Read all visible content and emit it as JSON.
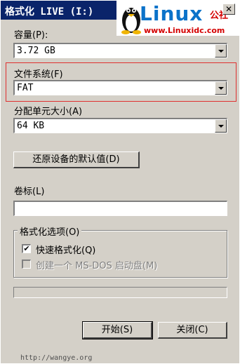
{
  "window": {
    "title": "格式化 LIVE (I:)",
    "close_glyph": "✕"
  },
  "overlay_logo": {
    "word": "Linux",
    "cn": "公社",
    "url": "www.Linuxidc.com"
  },
  "capacity": {
    "label": "容量(P):",
    "value": "3.72 GB"
  },
  "filesystem": {
    "label": "文件系统(F)",
    "value": "FAT"
  },
  "allocation": {
    "label": "分配单元大小(A)",
    "value": "64 KB"
  },
  "restore_defaults_label": "还原设备的默认值(D)",
  "volume": {
    "label": "卷标(L)",
    "value": ""
  },
  "format_options": {
    "title": "格式化选项(O)",
    "quick_format": {
      "label": "快速格式化(Q)",
      "checked": true,
      "check_glyph": "✔"
    },
    "msdos_disk": {
      "label": "创建一个 MS-DOS 启动盘(M)",
      "checked": false
    }
  },
  "progress": {
    "value": 0
  },
  "buttons": {
    "start": "开始(S)",
    "close": "关闭(C)"
  },
  "watermark": "http://wangye.org",
  "colors": {
    "titlebar": "#0a246a",
    "window_bg": "#d4d0c8",
    "highlight_border": "#e03030",
    "logo_blue": "#0b72c9",
    "logo_red": "#d40000"
  }
}
